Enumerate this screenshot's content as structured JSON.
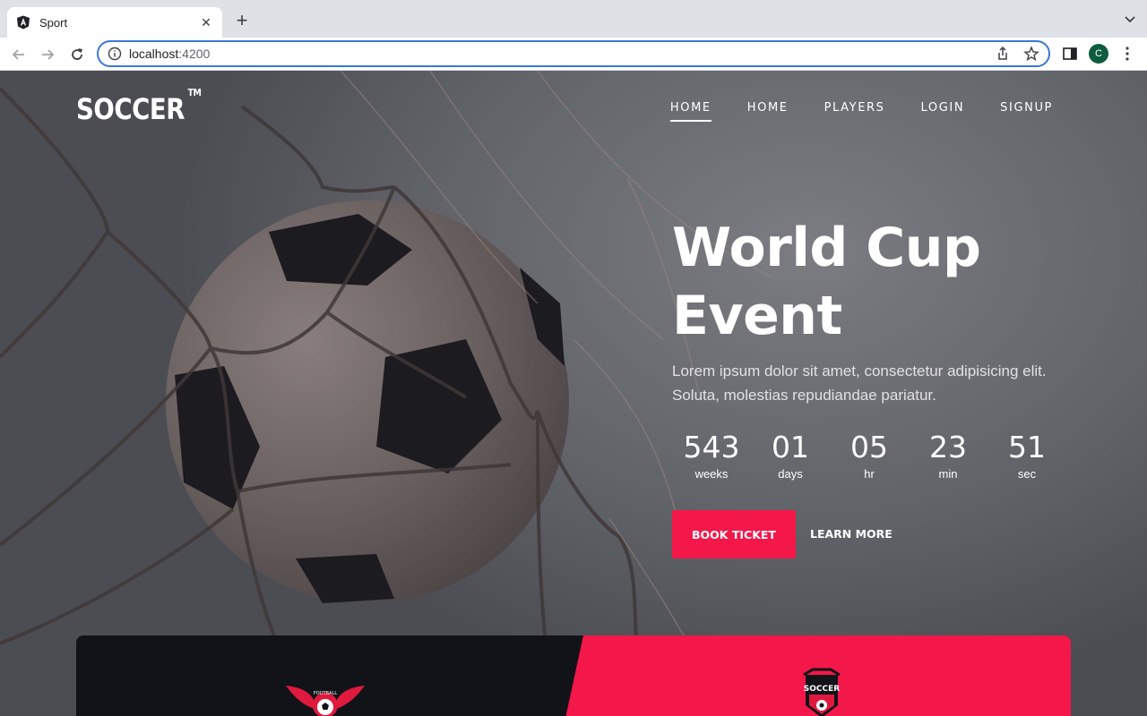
{
  "browser": {
    "tab_title": "Sport",
    "url_host": "localhost",
    "url_port": ":4200",
    "avatar_letter": "C"
  },
  "site": {
    "logo": "SOCCER",
    "logo_mark": "TM",
    "nav": [
      "HOME",
      "HOME",
      "PLAYERS",
      "LOGIN",
      "SIGNUP"
    ],
    "active_nav": 0
  },
  "hero": {
    "title_line1": "World Cup",
    "title_line2": "Event",
    "description": "Lorem ipsum dolor sit amet, consectetur adipisicing elit. Soluta, molestias repudiandae pariatur.",
    "countdown": [
      {
        "value": "543",
        "label": "weeks"
      },
      {
        "value": "01",
        "label": "days"
      },
      {
        "value": "05",
        "label": "hr"
      },
      {
        "value": "23",
        "label": "min"
      },
      {
        "value": "51",
        "label": "sec"
      }
    ],
    "book_button": "BOOK TICKET",
    "learn_button": "LEARN MORE"
  },
  "bottom": {
    "left_badge_text": "FOOTBALL",
    "right_badge_text": "SOCCER"
  },
  "colors": {
    "accent": "#f3174a",
    "dark_panel": "#121318"
  }
}
